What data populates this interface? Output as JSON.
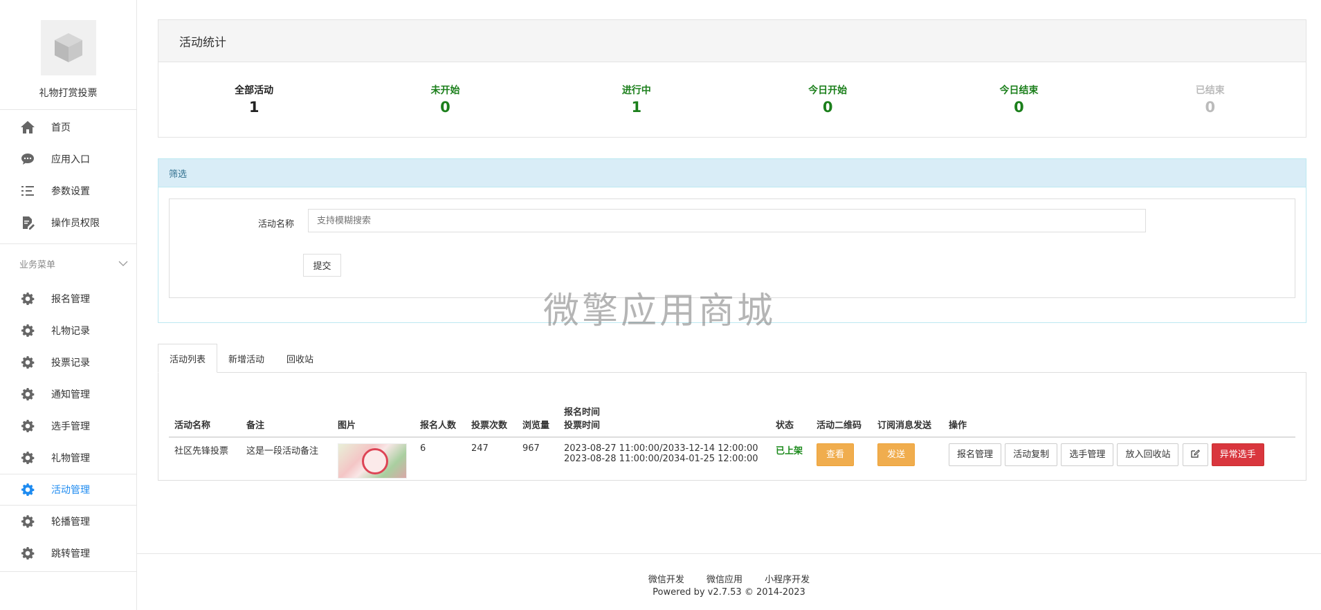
{
  "sidebar": {
    "app_name": "礼物打赏投票",
    "top_items": [
      {
        "label": "首页",
        "icon": "home-icon"
      },
      {
        "label": "应用入口",
        "icon": "chat-bubble-icon"
      },
      {
        "label": "参数设置",
        "icon": "list-settings-icon"
      },
      {
        "label": "操作员权限",
        "icon": "document-edit-icon"
      }
    ],
    "section_title": "业务菜单",
    "section_items": [
      {
        "label": "报名管理"
      },
      {
        "label": "礼物记录"
      },
      {
        "label": "投票记录"
      },
      {
        "label": "通知管理"
      },
      {
        "label": "选手管理"
      },
      {
        "label": "礼物管理"
      },
      {
        "label": "活动管理"
      },
      {
        "label": "轮播管理"
      },
      {
        "label": "跳转管理"
      }
    ],
    "active_item": "活动管理"
  },
  "stats": {
    "title": "活动统计",
    "items": [
      {
        "label": "全部活动",
        "value": "1",
        "color": "#222222"
      },
      {
        "label": "未开始",
        "value": "0",
        "color": "#1b7f1b"
      },
      {
        "label": "进行中",
        "value": "1",
        "color": "#1b7f1b"
      },
      {
        "label": "今日开始",
        "value": "0",
        "color": "#1b7f1b"
      },
      {
        "label": "今日结束",
        "value": "0",
        "color": "#1b7f1b"
      },
      {
        "label": "已结束",
        "value": "0",
        "color": "#bbbbbb"
      }
    ]
  },
  "filter": {
    "title": "筛选",
    "name_label": "活动名称",
    "name_placeholder": "支持模糊搜索",
    "submit_label": "提交"
  },
  "tabs": [
    {
      "label": "活动列表",
      "active": true
    },
    {
      "label": "新增活动",
      "active": false
    },
    {
      "label": "回收站",
      "active": false
    }
  ],
  "table": {
    "headers": {
      "name": "活动名称",
      "note": "备注",
      "image": "图片",
      "signups": "报名人数",
      "votes": "投票次数",
      "views": "浏览量",
      "time_line1": "报名时间",
      "time_line2": "投票时间",
      "status": "状态",
      "qrcode": "活动二维码",
      "subscribe": "订阅消息发送",
      "ops": "操作"
    },
    "rows": [
      {
        "name": "社区先锋投票",
        "note": "这是一段活动备注",
        "signups": "6",
        "votes": "247",
        "views": "967",
        "signup_time": "2023-08-27 11:00:00/2033-12-14 12:00:00",
        "vote_time": "2023-08-28 11:00:00/2034-01-25 12:00:00",
        "status": "已上架",
        "qrcode_btn": "查看",
        "subscribe_btn": "发送",
        "ops": [
          "报名管理",
          "活动复制",
          "选手管理",
          "放入回收站"
        ],
        "danger_btn": "异常选手"
      }
    ]
  },
  "watermark": "微擎应用商城",
  "footer": {
    "links": [
      "微信开发",
      "微信应用",
      "小程序开发"
    ],
    "copyright": "Powered by v2.7.53 © 2014-2023"
  }
}
